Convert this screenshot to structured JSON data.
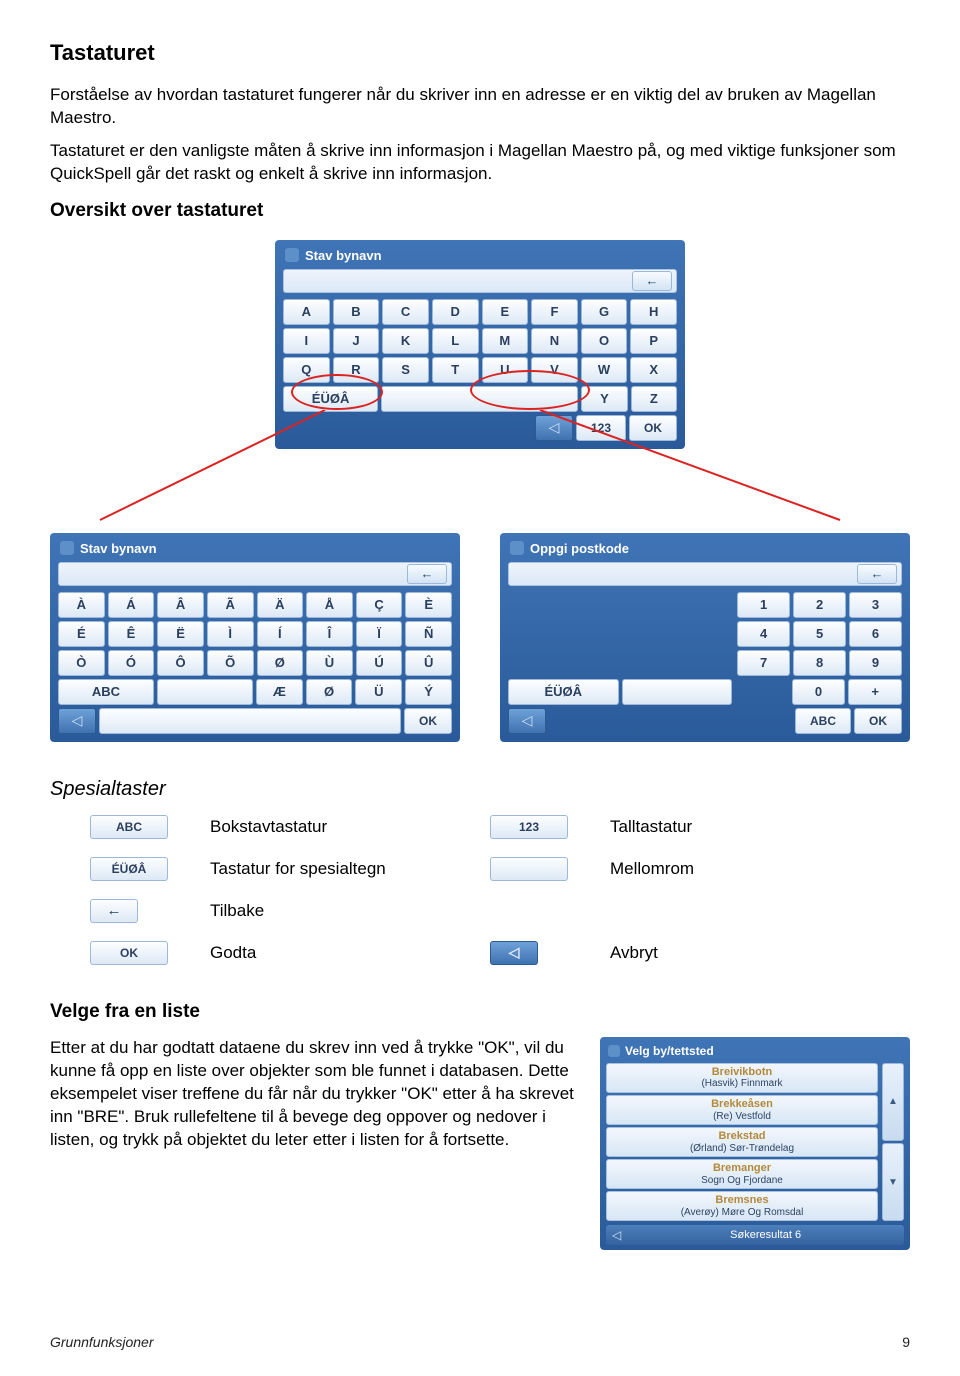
{
  "title": "Tastaturet",
  "intro_p1": "Forståelse av hvordan tastaturet fungerer når du skriver inn en adresse er en viktig del av bruken av Magellan Maestro.",
  "intro_p2": "Tastaturet er den vanligste måten å skrive inn informasjon i Magellan Maestro på, og med viktige funksjoner som QuickSpell går det raskt og enkelt å skrive inn informasjon.",
  "overview_head": "Oversikt over tastaturet",
  "kb_main": {
    "header": "Stav bynavn",
    "rows": [
      [
        "A",
        "B",
        "C",
        "D",
        "E",
        "F",
        "G",
        "H"
      ],
      [
        "I",
        "J",
        "K",
        "L",
        "M",
        "N",
        "O",
        "P"
      ],
      [
        "Q",
        "R",
        "S",
        "T",
        "U",
        "V",
        "W",
        "X"
      ]
    ],
    "specialKey": "ÉÜØÂ",
    "yz": [
      "Y",
      "Z"
    ],
    "bottom123": "123",
    "bottomOK": "OK"
  },
  "kb_left": {
    "header": "Stav bynavn",
    "rows": [
      [
        "À",
        "Á",
        "Â",
        "Ã",
        "Ä",
        "Å",
        "Ç",
        "È"
      ],
      [
        "É",
        "Ê",
        "Ë",
        "Ì",
        "Í",
        "Î",
        "Ï",
        "Ñ"
      ],
      [
        "Ò",
        "Ó",
        "Ô",
        "Õ",
        "Ø",
        "Ù",
        "Ú",
        "Û"
      ]
    ],
    "abcKey": "ABC",
    "tail": [
      "Æ",
      "Ø",
      "Ü",
      "Ý"
    ],
    "bottomOK": "OK"
  },
  "kb_right": {
    "header": "Oppgi postkode",
    "rows": [
      [
        "1",
        "2",
        "3"
      ],
      [
        "4",
        "5",
        "6"
      ],
      [
        "7",
        "8",
        "9"
      ],
      [
        "0",
        "+"
      ]
    ],
    "specialKey": "ÉÜØÂ",
    "bottomABC": "ABC",
    "bottomOK": "OK"
  },
  "special_head": "Spesialtaster",
  "special": {
    "abc": "ABC",
    "abc_label": "Bokstavtastatur",
    "num": "123",
    "num_label": "Talltastatur",
    "spec": "ÉÜØÂ",
    "spec_label": "Tastatur for spesialtegn",
    "space_label": "Mellomrom",
    "back_glyph": "←",
    "back_label": "Tilbake",
    "ok": "OK",
    "ok_label": "Godta",
    "cancel_glyph": "◁",
    "cancel_label": "Avbryt"
  },
  "list_head": "Velge fra en liste",
  "list_para": "Etter at du har godtatt dataene du skrev inn ved å trykke \"OK\", vil du kunne få opp en liste over objekter som ble funnet i databasen. Dette eksempelet viser treffene du får når du trykker \"OK\" etter å ha skrevet inn \"BRE\". Bruk rullefeltene til å bevege deg oppover og nedover i listen, og trykk på objektet du leter etter i listen for å fortsette.",
  "list_panel": {
    "header": "Velg by/tettsted",
    "items": [
      {
        "main": "Breivikbotn",
        "sub": "(Hasvik) Finnmark"
      },
      {
        "main": "Brekkeåsen",
        "sub": "(Re) Vestfold"
      },
      {
        "main": "Brekstad",
        "sub": "(Ørland) Sør-Trøndelag"
      },
      {
        "main": "Bremanger",
        "sub": "Sogn Og Fjordane"
      },
      {
        "main": "Bremsnes",
        "sub": "(Averøy) Møre Og Romsdal"
      }
    ],
    "footer": "Søkeresultat 6"
  },
  "footer_left": "Grunnfunksjoner",
  "footer_right": "9"
}
